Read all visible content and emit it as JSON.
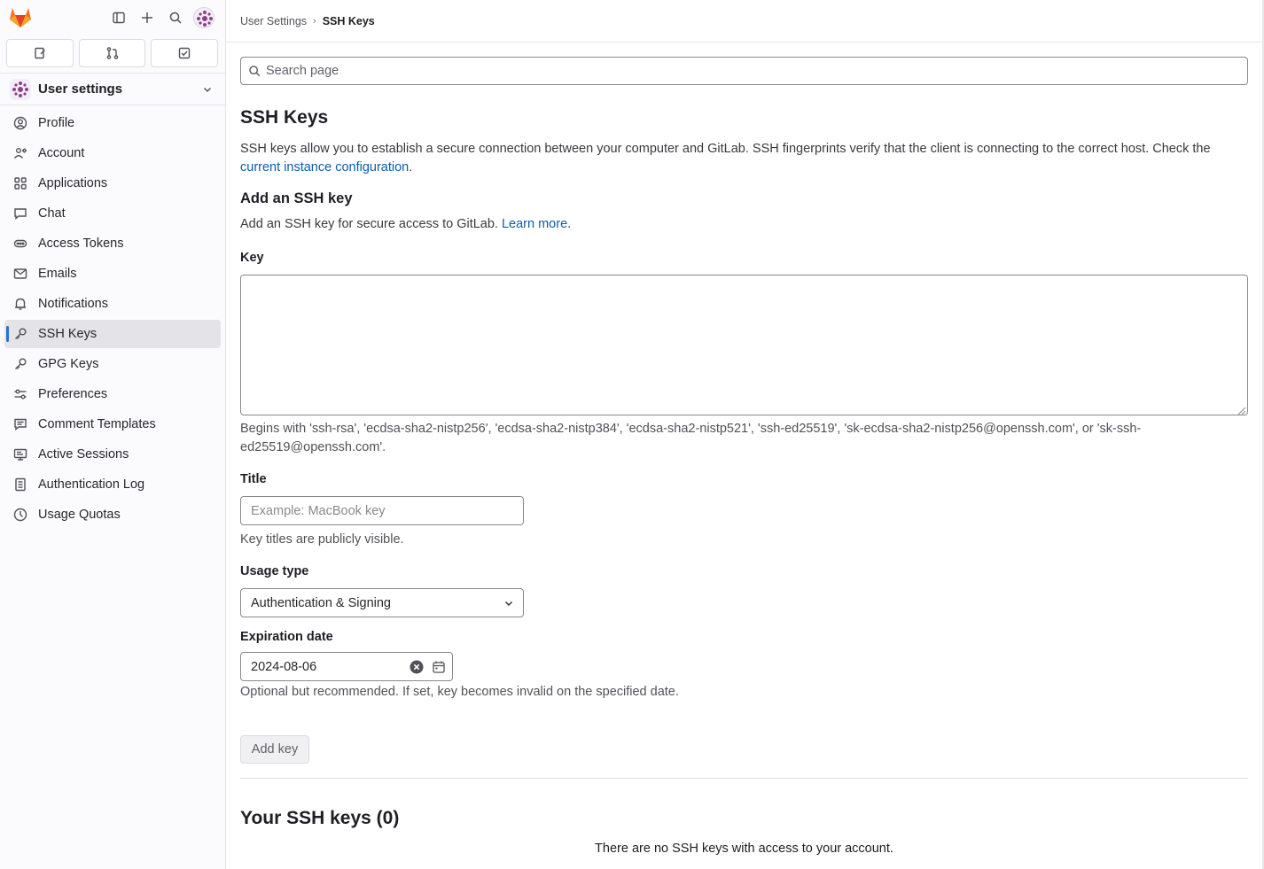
{
  "app": {
    "name": "GitLab",
    "brand_color": "#e24329"
  },
  "sidebar": {
    "context_title": "User settings",
    "quick_actions": [
      "issues-icon",
      "merge-requests-icon",
      "todo-icon"
    ],
    "items": [
      {
        "label": "Profile",
        "icon": "profile-icon",
        "active": false
      },
      {
        "label": "Account",
        "icon": "account-icon",
        "active": false
      },
      {
        "label": "Applications",
        "icon": "applications-icon",
        "active": false
      },
      {
        "label": "Chat",
        "icon": "chat-icon",
        "active": false
      },
      {
        "label": "Access Tokens",
        "icon": "token-icon",
        "active": false
      },
      {
        "label": "Emails",
        "icon": "mail-icon",
        "active": false
      },
      {
        "label": "Notifications",
        "icon": "bell-icon",
        "active": false
      },
      {
        "label": "SSH Keys",
        "icon": "key-icon",
        "active": true
      },
      {
        "label": "GPG Keys",
        "icon": "key-icon",
        "active": false
      },
      {
        "label": "Preferences",
        "icon": "preferences-icon",
        "active": false
      },
      {
        "label": "Comment Templates",
        "icon": "comment-icon",
        "active": false
      },
      {
        "label": "Active Sessions",
        "icon": "monitor-icon",
        "active": false
      },
      {
        "label": "Authentication Log",
        "icon": "log-icon",
        "active": false
      },
      {
        "label": "Usage Quotas",
        "icon": "quota-icon",
        "active": false
      }
    ],
    "active_color": "#1f75cb"
  },
  "breadcrumb": {
    "parent": "User Settings",
    "current": "SSH Keys"
  },
  "search": {
    "placeholder": "Search page"
  },
  "page": {
    "title": "SSH Keys",
    "intro_text": "SSH keys allow you to establish a secure connection between your computer and GitLab. SSH fingerprints verify that the client is connecting to the correct host. Check the ",
    "intro_link": "current instance configuration",
    "intro_end": ".",
    "add_heading": "Add an SSH key",
    "add_desc": "Add an SSH key for secure access to GitLab. ",
    "learn_more": "Learn more",
    "add_desc_end": "."
  },
  "form": {
    "key_label": "Key",
    "key_value": "",
    "key_help": "Begins with 'ssh-rsa', 'ecdsa-sha2-nistp256', 'ecdsa-sha2-nistp384', 'ecdsa-sha2-nistp521', 'ssh-ed25519', 'sk-ecdsa-sha2-nistp256@openssh.com', or 'sk-ssh-ed25519@openssh.com'.",
    "title_label": "Title",
    "title_placeholder": "Example: MacBook key",
    "title_help": "Key titles are publicly visible.",
    "usage_label": "Usage type",
    "usage_value": "Authentication & Signing",
    "expiration_label": "Expiration date",
    "expiration_value": "2024-08-06",
    "expiration_help": "Optional but recommended. If set, key becomes invalid on the specified date.",
    "submit_label": "Add key"
  },
  "keys_list": {
    "title": "Your SSH keys (0)",
    "empty_text": "There are no SSH keys with access to your account."
  }
}
